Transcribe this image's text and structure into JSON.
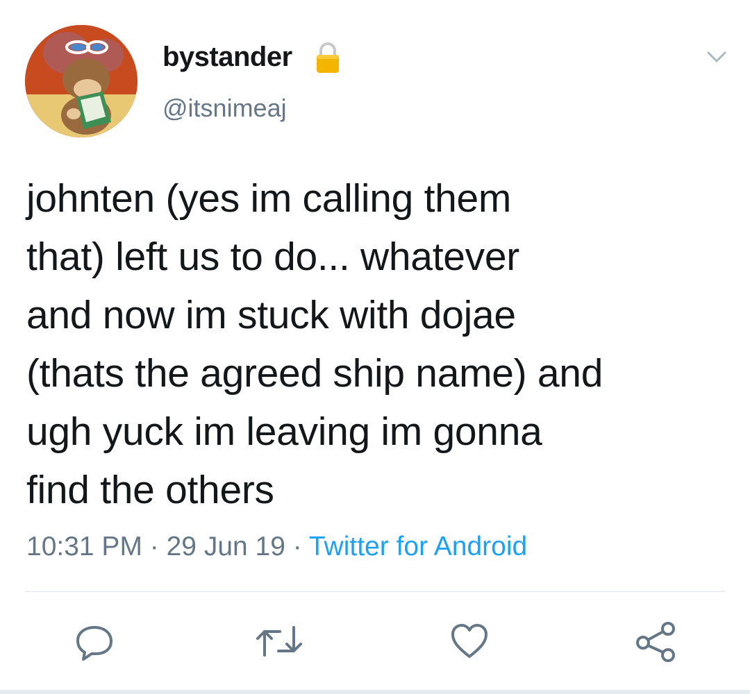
{
  "user": {
    "display_name": "bystander",
    "handle": "@itsnimeaj",
    "protected": true
  },
  "tweet": {
    "text": "johnten (yes im calling them\nthat) left us to do... whatever\nand now im stuck with dojae\n(thats the agreed ship name) and\nugh yuck im leaving im gonna\nfind the others",
    "time": "10:31 PM",
    "separator": " · ",
    "date": "29 Jun 19",
    "source": "Twitter for Android"
  },
  "icons": {
    "avatar": "avatar-image",
    "lock": "lock-icon",
    "menu": "chevron-down-icon",
    "reply": "reply-icon",
    "retweet": "retweet-icon",
    "like": "heart-icon",
    "share": "share-icon"
  },
  "colors": {
    "text": "#14171a",
    "secondary": "#657786",
    "link": "#1da1f2",
    "divider": "#e1e8ed",
    "lock": "#f4b400"
  }
}
